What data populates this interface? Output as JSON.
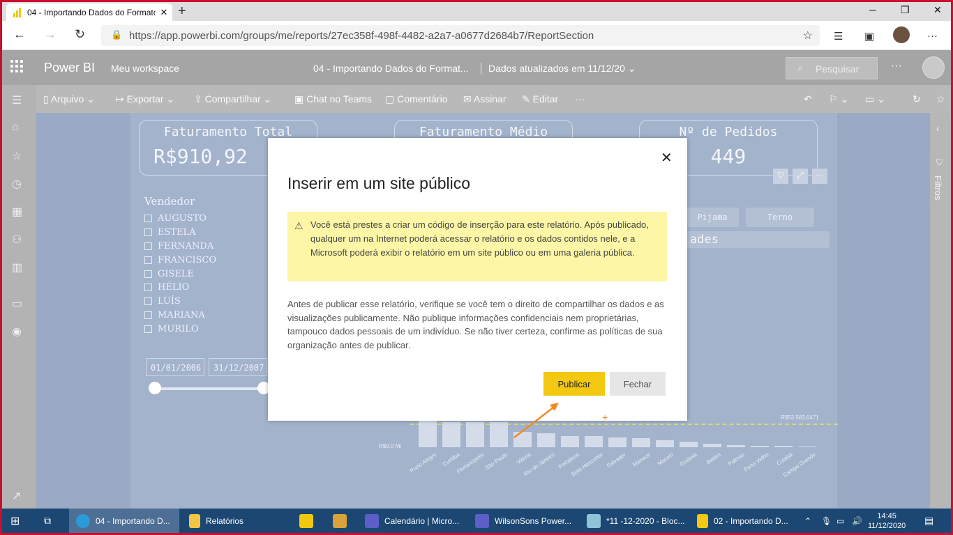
{
  "browser": {
    "tab_title": "04 - Importando Dados do Formato",
    "tab_close": "✕",
    "new_tab": "+",
    "url": "https://app.powerbi.com/groups/me/reports/27ec358f-498f-4482-a2a7-a0677d2684b7/ReportSection",
    "minimize": "─",
    "restore": "❐",
    "close": "✕"
  },
  "pbi": {
    "brand": "Power BI",
    "workspace": "Meu workspace",
    "report_title": "04 - Importando Dados do Format...",
    "updated": "Dados atualizados em 11/12/20",
    "search_placeholder": "Pesquisar",
    "more": "···"
  },
  "toolbar": {
    "arquivo": "Arquivo",
    "exportar": "Exportar",
    "compartilhar": "Compartilhar",
    "chat": "Chat no Teams",
    "comentario": "Comentário",
    "assinar": "Assinar",
    "editar": "Editar",
    "more": "···"
  },
  "report": {
    "cards": [
      {
        "label": "Faturamento Total",
        "value": "R$910,92"
      },
      {
        "label": "Faturamento Médio",
        "value": ""
      },
      {
        "label": "Nº de Pedidos",
        "value": "449"
      }
    ],
    "seller_title": "Vendedor",
    "sellers": [
      "AUGUSTO",
      "ESTELA",
      "FERNANDA",
      "FRANCISCO",
      "GISELE",
      "HÉLIO",
      "LUÍS",
      "MARIANA",
      "MURILO"
    ],
    "date_from": "01/01/2006",
    "date_to": "31/12/2007",
    "segments": [
      "Pijama",
      "Terno"
    ],
    "chart_header": "ades"
  },
  "chart_data": {
    "type": "bar",
    "title": "",
    "categories": [
      "Porto Alegre",
      "Curitiba",
      "Florianópolis",
      "São Paulo",
      "Vitória",
      "Rio de Janeiro",
      "Fortaleza",
      "Belo Horizonte",
      "Salvador",
      "Manaus",
      "Maceió",
      "Goiânia",
      "Belém",
      "Palmas",
      "Porto Velho",
      "Cuiabá",
      "Campo Grande"
    ],
    "reference_label": "R$53.583,6471",
    "zero_label": "R$0,0 Mi"
  },
  "dialog": {
    "title": "Inserir em um site público",
    "warning": "Você está prestes a criar um código de inserção para este relatório. Após publicado, qualquer um na Internet poderá acessar o relatório e os dados contidos nele, e a Microsoft poderá exibir o relatório em um site público ou em uma galeria pública.",
    "body": "Antes de publicar esse relatório, verifique se você tem o direito de compartilhar os dados e as visualizações publicamente. Não publique informações confidenciais nem proprietárias, tampouco dados pessoais de um indivíduo. Se não tiver certeza, confirme as políticas de sua organização antes de publicar.",
    "publish": "Publicar",
    "close": "Fechar"
  },
  "filters_label": "Filtros",
  "taskbar": {
    "items": [
      "04 - Importando D...",
      "Relatórios",
      "Calendário | Micro...",
      "WilsonSons Power...",
      "*11 -12-2020 - Bloc...",
      "02 - Importando D..."
    ],
    "time": "14:45",
    "date": "11/12/2020"
  },
  "colors": {
    "accent": "#f2c811",
    "warning_bg": "#fdf6a6",
    "taskbar": "#1c4773",
    "annotation_arrow": "#f08a24"
  }
}
